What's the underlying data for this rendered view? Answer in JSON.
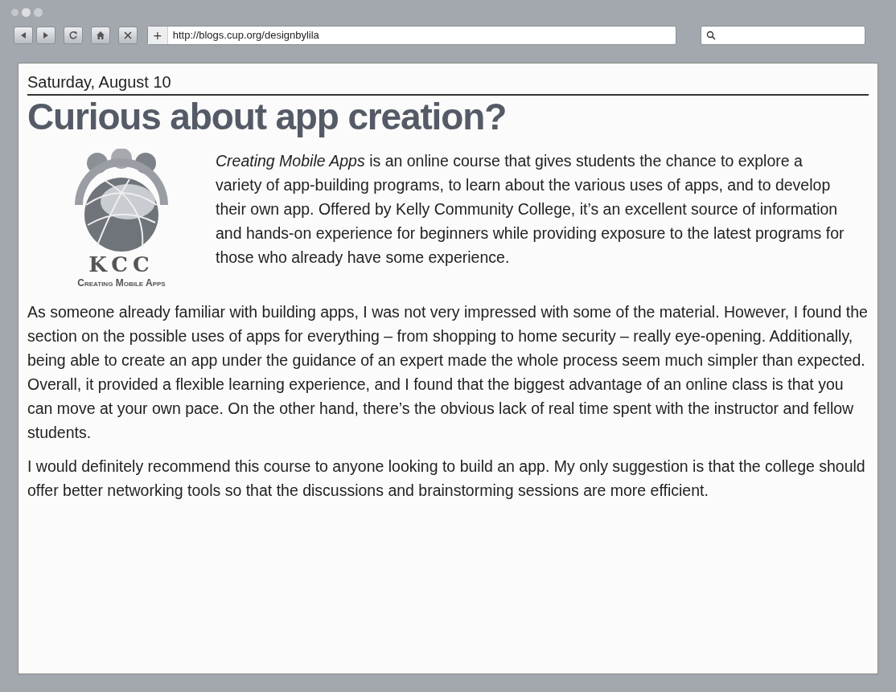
{
  "browser": {
    "url": "http://blogs.cup.org/designbylila",
    "url_prefix": "+"
  },
  "post": {
    "date": "Saturday, August 10",
    "title": "Curious about app creation?",
    "logo": {
      "letters": "KCC",
      "caption": "Creating Mobile Apps"
    },
    "paragraphs": [
      "*Creating Mobile Apps* is an online course that gives students the chance to explore a variety of app-building programs, to learn about the various uses of apps, and to develop their own app. Offered by Kelly Community College, it’s an excellent source of information and hands-on experience for beginners while providing exposure to the latest programs for those who already have some experience.",
      "As someone already familiar with building apps, I was not very impressed with some of the material. However, I found the section on the possible uses of apps for everything – from shopping to home security – really eye-opening. Additionally, being able to create an app under the guidance of an expert made the whole process seem much simpler than expected. Overall, it provided a flexible learning experience, and I found that the biggest advantage of an online class is that you can move at your own pace. On the other hand, there’s the obvious lack of real time spent with the instructor and fellow students.",
      "I would definitely recommend this course to anyone looking to build an app. My only suggestion is that the college should offer better networking tools so that the discussions and brainstorming sessions are more efficient."
    ]
  }
}
